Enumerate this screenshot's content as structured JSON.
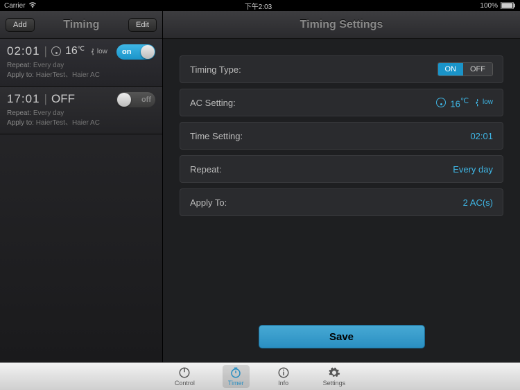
{
  "status": {
    "carrier": "Carrier",
    "time": "下午2:03",
    "battery": "100%"
  },
  "sidebar": {
    "title": "Timing",
    "add_label": "Add",
    "edit_label": "Edit",
    "timers": [
      {
        "time": "02:01",
        "state_label": "",
        "temp": "16",
        "temp_unit": "℃",
        "fan": "low",
        "toggled_on": true,
        "toggle_on_label": "on",
        "repeat_label": "Repeat:",
        "repeat_value": "Every day",
        "apply_label": "Apply to:",
        "apply_value": "HaierTest、Haier AC"
      },
      {
        "time": "17:01",
        "state_label": "OFF",
        "temp": "",
        "temp_unit": "",
        "fan": "",
        "toggled_on": false,
        "toggle_off_label": "off",
        "repeat_label": "Repeat:",
        "repeat_value": "Every day",
        "apply_label": "Apply to:",
        "apply_value": "HaierTest、Haier AC"
      }
    ]
  },
  "main": {
    "title": "Timing Settings",
    "rows": {
      "timing_type": {
        "label": "Timing Type:",
        "on": "ON",
        "off": "OFF",
        "active": "ON"
      },
      "ac_setting": {
        "label": "AC Setting:",
        "temp": "16",
        "temp_unit": "℃",
        "fan": "low"
      },
      "time_setting": {
        "label": "Time Setting:",
        "value": "02:01"
      },
      "repeat": {
        "label": "Repeat:",
        "value": "Every day"
      },
      "apply_to": {
        "label": "Apply To:",
        "value": "2 AC(s)"
      }
    },
    "save_label": "Save"
  },
  "tabs": {
    "control": "Control",
    "timer": "Timer",
    "info": "Info",
    "settings": "Settings"
  }
}
